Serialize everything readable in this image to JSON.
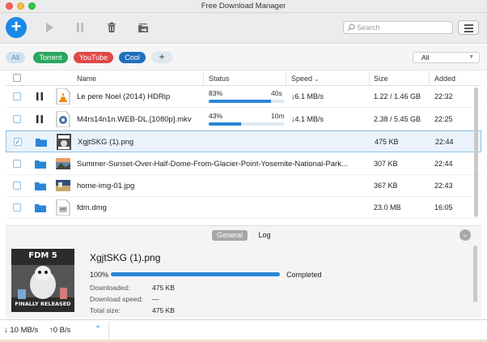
{
  "window": {
    "title": "Free Download Manager"
  },
  "toolbar": {
    "add_symbol": "+",
    "search_placeholder": "Search",
    "icons": [
      "add-icon",
      "play-icon",
      "pause-icon",
      "trash-icon",
      "move-icon",
      "menu-icon"
    ]
  },
  "tags": {
    "all": "All",
    "torrent": "Torrent",
    "youtube": "YouTube",
    "cool": "Cool",
    "add": "+",
    "filter_value": "All",
    "colors": {
      "torrent": "#2aa760",
      "youtube": "#e04848",
      "cool": "#1f6fc0"
    }
  },
  "table": {
    "headers": {
      "name": "Name",
      "status": "Status",
      "speed": "Speed",
      "size": "Size",
      "added": "Added"
    },
    "rows": [
      {
        "name": "Le pere Noel (2014) HDRip",
        "status_pct": "83%",
        "eta": "40s",
        "progress": 0.83,
        "speed": "↓6.1 MB/s",
        "size": "1.22 / 1.46 GB",
        "added": "22:32",
        "action": "pause-icon",
        "thumb": "vlc-file-icon"
      },
      {
        "name": "M4rs14n1n.WEB-DL.[1080p].mkv",
        "status_pct": "43%",
        "eta": "10m",
        "progress": 0.43,
        "speed": "↓4.1 MB/s",
        "size": "2.38 / 5.45 GB",
        "added": "22:25",
        "action": "pause-icon",
        "thumb": "video-file-icon"
      },
      {
        "name": "XgjtSKG (1).png",
        "size": "475 KB",
        "added": "22:44",
        "action": "folder-icon",
        "thumb": "image-thumbnail",
        "selected": true
      },
      {
        "name": "Summer-Sunset-Over-Half-Dome-From-Glacier-Point-Yosemite-National-Park...",
        "size": "307 KB",
        "added": "22:44",
        "action": "folder-icon",
        "thumb": "image-thumbnail"
      },
      {
        "name": "home-img-01.jpg",
        "size": "367 KB",
        "added": "22:43",
        "action": "folder-icon",
        "thumb": "image-thumbnail"
      },
      {
        "name": "fdm.dmg",
        "size": "23.0 MB",
        "added": "16:05",
        "action": "folder-icon",
        "thumb": "disk-image-icon"
      }
    ]
  },
  "details": {
    "tabs": {
      "general": "General",
      "log": "Log"
    },
    "file_name": "XgjtSKG (1).png",
    "percent": "100%",
    "progress": 1.0,
    "status": "Completed",
    "downloaded_label": "Downloaded:",
    "downloaded_value": "475 KB",
    "speed_label": "Download speed:",
    "speed_value": "—",
    "total_label": "Total size:",
    "total_value": "475 KB",
    "preview": {
      "top_text": "FDM 5",
      "bottom_text": "FINALLY RELEASED"
    }
  },
  "statusbar": {
    "down": "↓ 10 MB/s",
    "up": "↑0 B/s"
  }
}
